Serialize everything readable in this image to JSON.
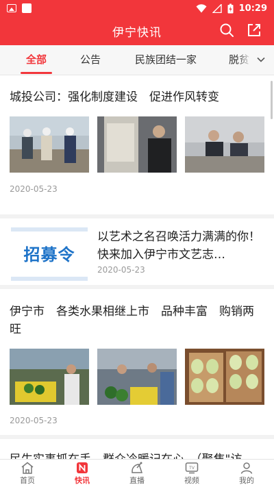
{
  "status_bar": {
    "time": "10:29"
  },
  "header": {
    "title": "伊宁快讯"
  },
  "tabs": [
    {
      "label": "全部",
      "active": true
    },
    {
      "label": "公告",
      "active": false
    },
    {
      "label": "民族团结一家",
      "active": false
    },
    {
      "label": "脱贫",
      "active": false
    }
  ],
  "articles": [
    {
      "title": "城投公司：强化制度建设　促进作风转变",
      "date": "2020-05-23",
      "image_count": 3
    },
    {
      "title": "以艺术之名召唤活力满满的你！　快来加入伊宁市文艺志…",
      "date": "2020-05-23",
      "image_text": "招募令"
    },
    {
      "title": "伊宁市　各类水果相继上市　品种丰富　购销两旺",
      "date": "2020-05-23",
      "image_count": 3
    },
    {
      "title": "民生实事抓在手　群众冷暖记在心　（聚焦\"访"
    }
  ],
  "bottom_nav": [
    {
      "label": "首页",
      "icon": "home-icon",
      "active": false
    },
    {
      "label": "快讯",
      "icon": "news-icon",
      "active": true
    },
    {
      "label": "直播",
      "icon": "live-icon",
      "active": false
    },
    {
      "label": "视频",
      "icon": "tv-icon",
      "active": false
    },
    {
      "label": "我的",
      "icon": "profile-icon",
      "active": false
    }
  ],
  "colors": {
    "brand": "#f2363b",
    "muted_text": "#999999",
    "tab_bg": "#f7f7f7"
  }
}
